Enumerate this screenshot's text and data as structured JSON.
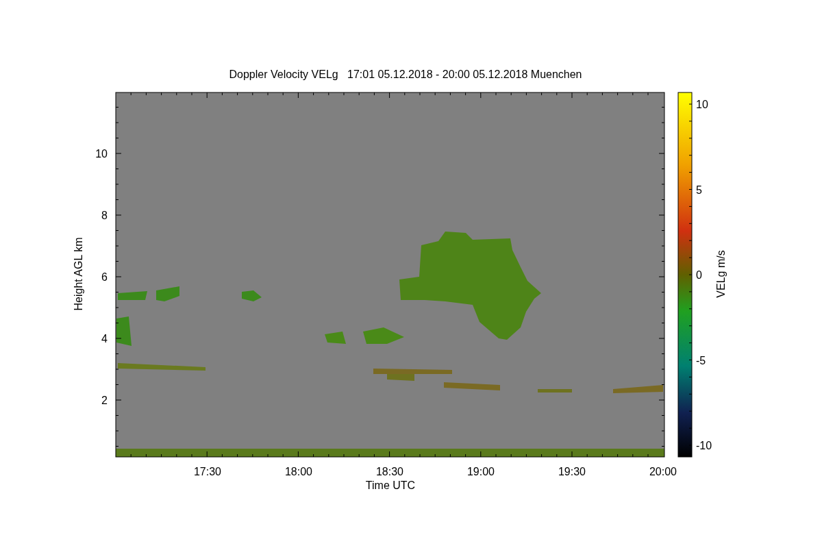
{
  "title": "Doppler Velocity VELg   17:01 05.12.2018 - 20:00 05.12.2018 Muenchen",
  "x_axis": {
    "label": "Time UTC",
    "ticks": [
      "17:30",
      "18:00",
      "18:30",
      "19:00",
      "19:30",
      "20:00"
    ]
  },
  "y_axis": {
    "label": "Height AGL km",
    "ticks": [
      "10",
      "8",
      "6",
      "4",
      "2"
    ]
  },
  "colorbar": {
    "label": "VELg m/s",
    "ticks": [
      "10",
      "5",
      "0",
      "-5",
      "-10"
    ]
  }
}
